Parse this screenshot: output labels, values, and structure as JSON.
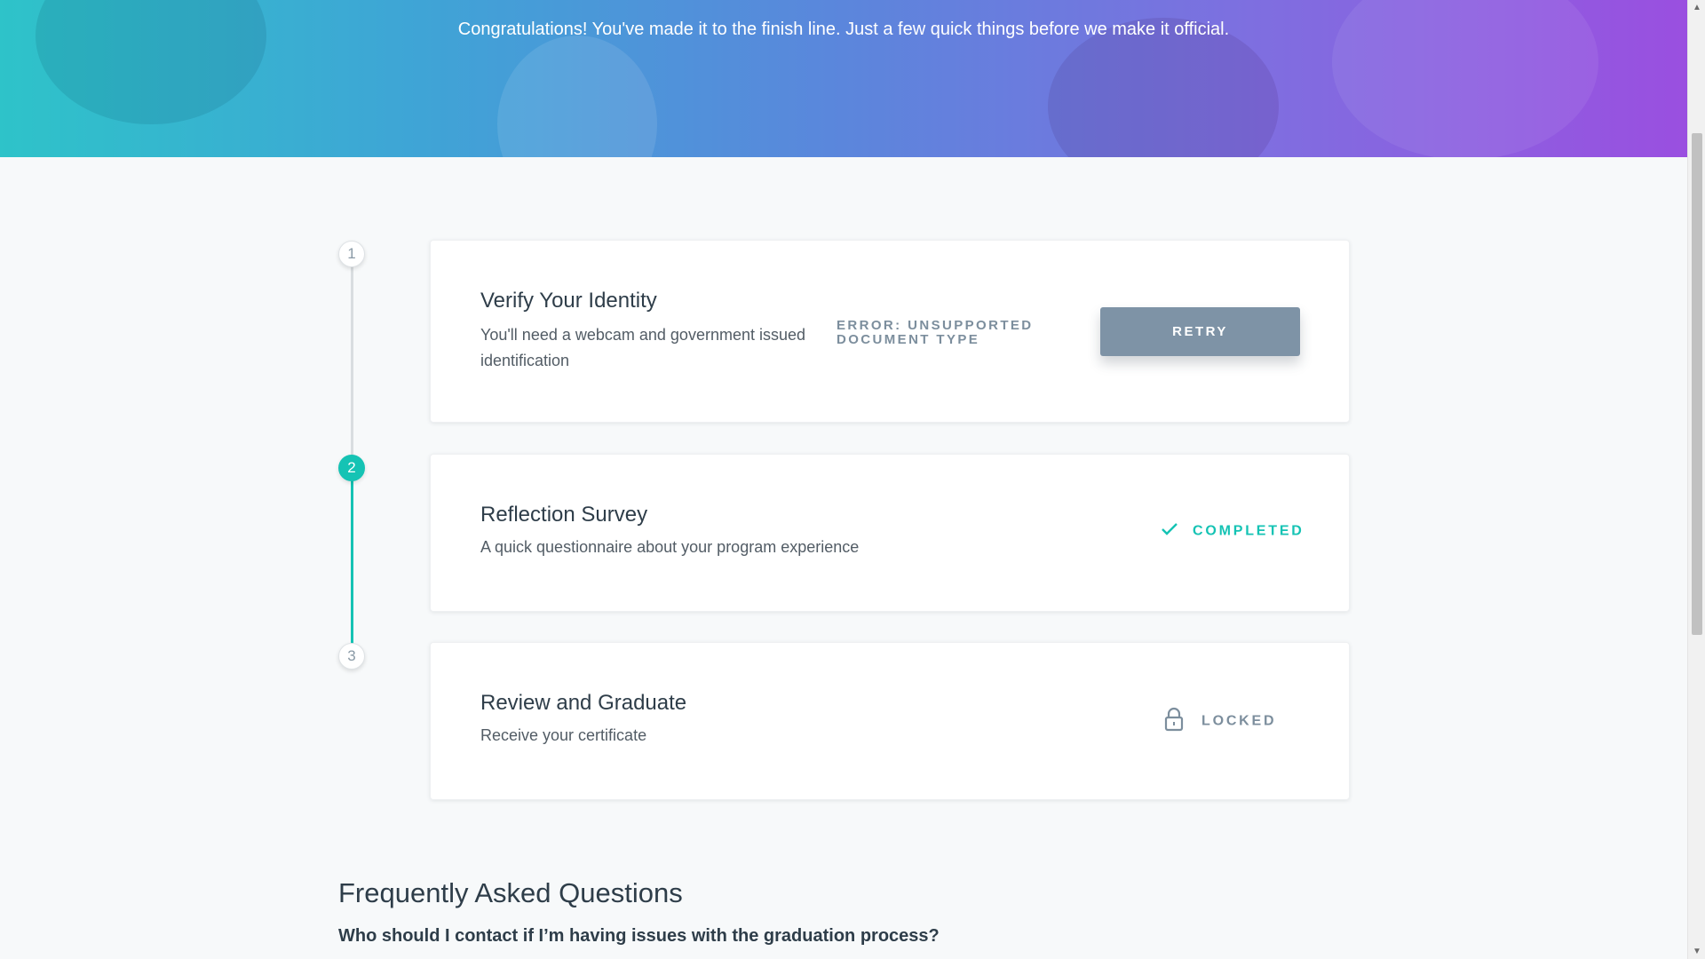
{
  "hero": {
    "message": "Congratulations! You've made it to the finish line. Just a few quick things before we make it official."
  },
  "steps": [
    {
      "number": "1",
      "title": "Verify Your Identity",
      "description": "You'll need a webcam and government issued identification",
      "error": "ERROR: UNSUPPORTED DOCUMENT TYPE",
      "action_label": "RETRY"
    },
    {
      "number": "2",
      "title": "Reflection Survey",
      "description": "A quick questionnaire about your program experience",
      "status_label": "COMPLETED",
      "status_icon": "check-icon"
    },
    {
      "number": "3",
      "title": "Review and Graduate",
      "description": "Receive your certificate",
      "status_label": "LOCKED",
      "status_icon": "lock-icon"
    }
  ],
  "faq": {
    "title": "Frequently Asked Questions",
    "question": "Who should I contact if I’m having issues with the graduation process?"
  },
  "colors": {
    "accent": "#15c3b4",
    "button": "#7e93a6",
    "muted": "#7c8e9d",
    "hero_start": "#2ec3c9",
    "hero_end": "#9a4fe0"
  }
}
